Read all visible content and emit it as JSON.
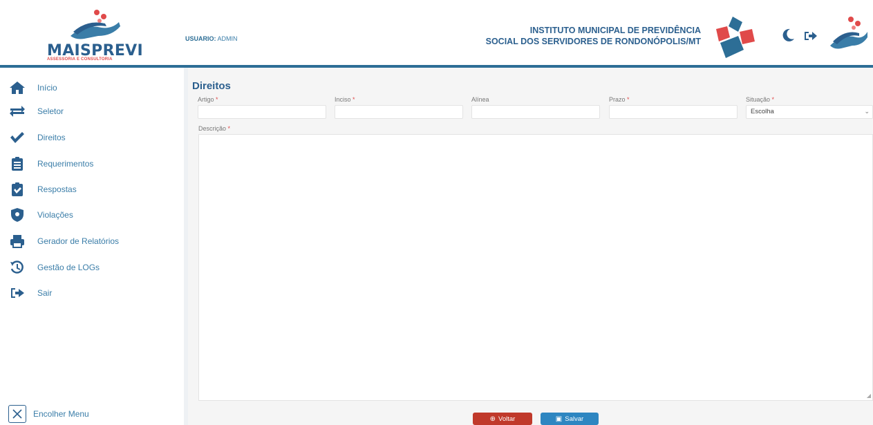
{
  "header": {
    "logo_text": "MAISPREVI",
    "logo_subtitle": "ASSESSORIA E CONSULTORIA",
    "user_label": "USUARIO:",
    "user_value": "ADMIN",
    "institution_line1": "INSTITUTO MUNICIPAL DE PREVIDÊNCIA",
    "institution_line2": "SOCIAL DOS SERVIDORES DE RONDONÓPOLIS/MT",
    "icons": [
      "emblem-icon",
      "moon-icon",
      "logout-icon",
      "hand-logo-icon"
    ]
  },
  "sidebar": {
    "items": [
      {
        "label": "Início",
        "icon": "home-icon"
      },
      {
        "label": "Seletor",
        "icon": "swap-arrows-icon"
      },
      {
        "label": "Direitos",
        "icon": "check-icon"
      },
      {
        "label": "Requerimentos",
        "icon": "clipboard-list-icon"
      },
      {
        "label": "Respostas",
        "icon": "clipboard-check-icon"
      },
      {
        "label": "Violações",
        "icon": "shield-icon"
      },
      {
        "label": "Gerador de Relatórios",
        "icon": "printer-icon"
      },
      {
        "label": "Gestão de LOGs",
        "icon": "history-icon"
      },
      {
        "label": "Sair",
        "icon": "sign-out-icon"
      }
    ],
    "collapse_label": "Encolher Menu"
  },
  "main": {
    "title": "Direitos",
    "fields": {
      "artigo": {
        "label": "Artigo",
        "value": ""
      },
      "inciso": {
        "label": "Inciso",
        "value": ""
      },
      "alinea": {
        "label": "Alínea",
        "value": ""
      },
      "prazo": {
        "label": "Prazo",
        "value": ""
      },
      "situacao": {
        "label": "Situação",
        "value": "Escolha"
      }
    },
    "descricao": {
      "label": "Descrição",
      "value": ""
    },
    "buttons": {
      "voltar": "Voltar",
      "salvar": "Salvar"
    }
  },
  "colors": {
    "brand_blue": "#2b5f8e",
    "link_blue": "#3a7da8",
    "required_red": "#e04a4a",
    "voltar_red": "#c0392b",
    "salvar_blue": "#2e86c1"
  }
}
